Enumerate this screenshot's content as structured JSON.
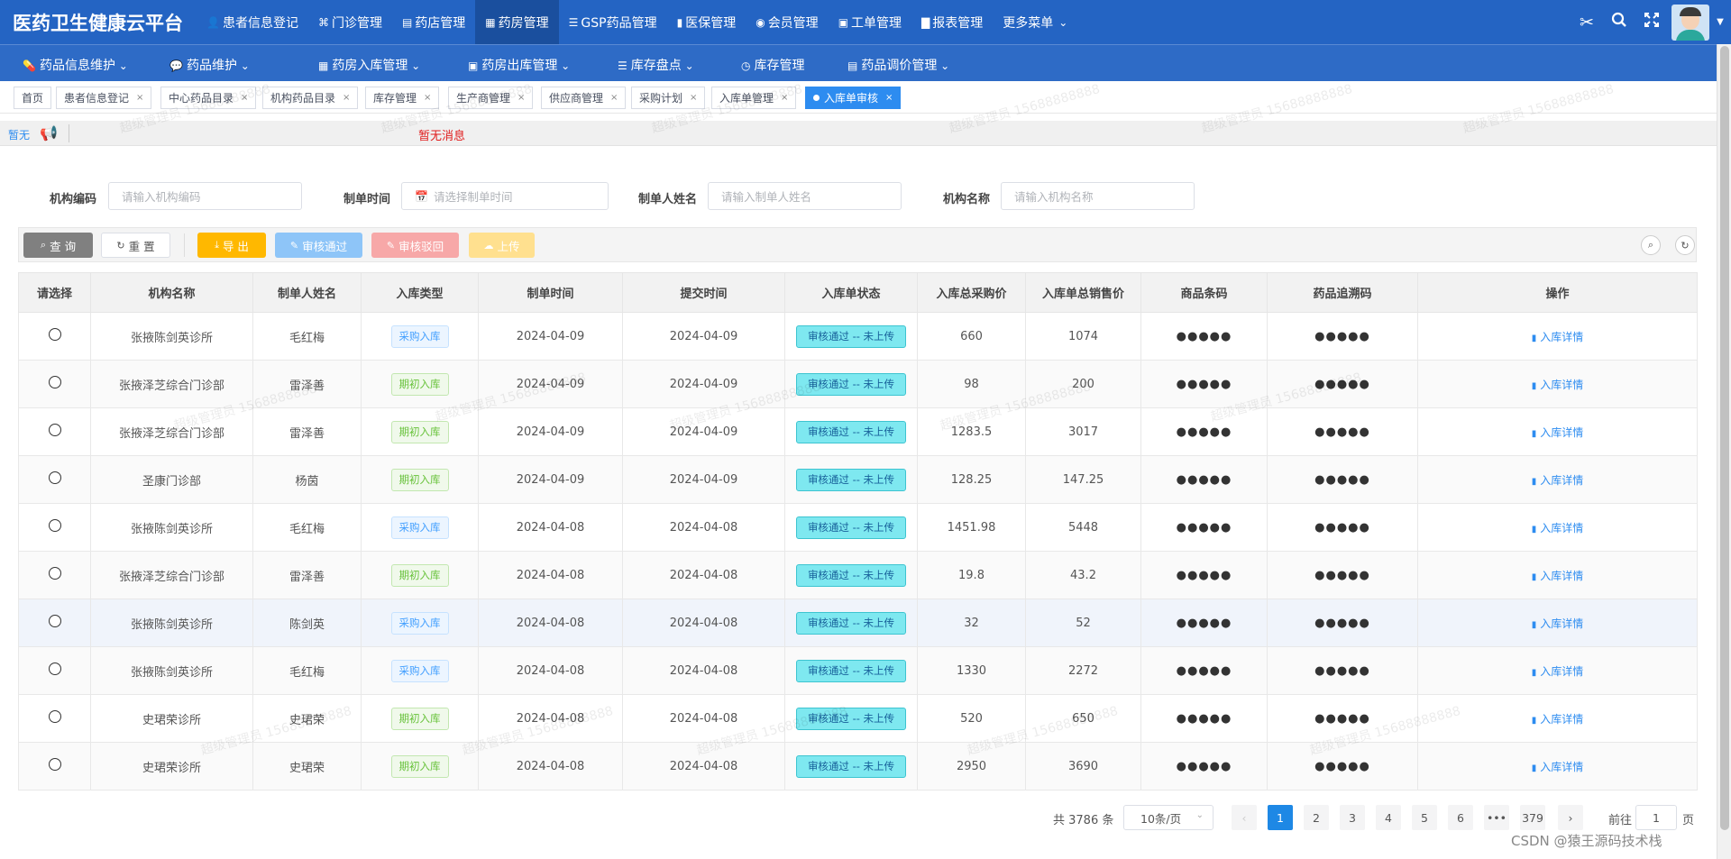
{
  "app": {
    "title": "医药卫生健康云平台"
  },
  "top_menu": [
    {
      "label": "患者信息登记",
      "icon": "user-icon"
    },
    {
      "label": "门诊管理",
      "icon": "puzzle-icon"
    },
    {
      "label": "药店管理",
      "icon": "store-icon"
    },
    {
      "label": "药房管理",
      "icon": "pharmacy-icon",
      "active": true
    },
    {
      "label": "GSP药品管理",
      "icon": "list-icon"
    },
    {
      "label": "医保管理",
      "icon": "card-icon"
    },
    {
      "label": "会员管理",
      "icon": "github-icon"
    },
    {
      "label": "工单管理",
      "icon": "ticket-icon"
    },
    {
      "label": "报表管理",
      "icon": "chart-icon"
    },
    {
      "label": "更多菜单",
      "icon": "chevron-down-icon"
    }
  ],
  "sub_menu": [
    {
      "label": "药品信息维护",
      "icon": "pill-icon"
    },
    {
      "label": "药品维护",
      "icon": "chat-icon"
    },
    {
      "label": "药房入库管理",
      "icon": "grid-icon"
    },
    {
      "label": "药房出库管理",
      "icon": "box-icon"
    },
    {
      "label": "库存盘点",
      "icon": "list-icon"
    },
    {
      "label": "库存管理",
      "icon": "clock-icon"
    },
    {
      "label": "药品调价管理",
      "icon": "doc-icon"
    }
  ],
  "tags": [
    {
      "label": "首页"
    },
    {
      "label": "患者信息登记"
    },
    {
      "label": "中心药品目录"
    },
    {
      "label": "机构药品目录"
    },
    {
      "label": "库存管理"
    },
    {
      "label": "生产商管理"
    },
    {
      "label": "供应商管理"
    },
    {
      "label": "采购计划"
    },
    {
      "label": "入库单管理"
    },
    {
      "label": "入库单审核",
      "active": true
    }
  ],
  "message": {
    "left": "暂无",
    "text": "暂无消息"
  },
  "filters": [
    {
      "label": "机构编码",
      "placeholder": "请输入机构编码"
    },
    {
      "label": "制单时间",
      "placeholder": "请选择制单时间"
    },
    {
      "label": "制单人姓名",
      "placeholder": "请输入制单人姓名"
    },
    {
      "label": "机构名称",
      "placeholder": "请输入机构名称"
    }
  ],
  "toolbar": {
    "search": "查 询",
    "reset": "重 置",
    "export": "导 出",
    "approve": "审核通过",
    "reject": "审核驳回",
    "upload": "上传"
  },
  "colors": {
    "primary": "#2464c3",
    "search_btn": "#808080",
    "export_btn": "#ffb800",
    "approve_btn": "#8ec5f8",
    "reject_btn": "#f7a8a8",
    "upload_btn": "#ffe08f"
  },
  "table": {
    "columns": [
      "请选择",
      "机构名称",
      "制单人姓名",
      "入库类型",
      "制单时间",
      "提交时间",
      "入库单状态",
      "入库总采购价",
      "入库单总销售价",
      "商品条码",
      "药品追溯码",
      "操作"
    ],
    "rows": [
      {
        "org": "张掖陈剑英诊所",
        "maker": "毛红梅",
        "type": "采购入库",
        "type_kind": "cg",
        "created": "2024-04-09",
        "submitted": "2024-04-09",
        "status": "审核通过 -- 未上传",
        "buy": "660",
        "sell": "1074",
        "barcode": "●●●●●",
        "trace": "●●●●●",
        "op": "入库详情"
      },
      {
        "org": "张掖泽芝综合门诊部",
        "maker": "雷泽善",
        "type": "期初入库",
        "type_kind": "qc",
        "created": "2024-04-09",
        "submitted": "2024-04-09",
        "status": "审核通过 -- 未上传",
        "buy": "98",
        "sell": "200",
        "barcode": "●●●●●",
        "trace": "●●●●●",
        "op": "入库详情"
      },
      {
        "org": "张掖泽芝综合门诊部",
        "maker": "雷泽善",
        "type": "期初入库",
        "type_kind": "qc",
        "created": "2024-04-09",
        "submitted": "2024-04-09",
        "status": "审核通过 -- 未上传",
        "buy": "1283.5",
        "sell": "3017",
        "barcode": "●●●●●",
        "trace": "●●●●●",
        "op": "入库详情"
      },
      {
        "org": "圣康门诊部",
        "maker": "杨茵",
        "type": "期初入库",
        "type_kind": "qc",
        "created": "2024-04-09",
        "submitted": "2024-04-09",
        "status": "审核通过 -- 未上传",
        "buy": "128.25",
        "sell": "147.25",
        "barcode": "●●●●●",
        "trace": "●●●●●",
        "op": "入库详情"
      },
      {
        "org": "张掖陈剑英诊所",
        "maker": "毛红梅",
        "type": "采购入库",
        "type_kind": "cg",
        "created": "2024-04-08",
        "submitted": "2024-04-08",
        "status": "审核通过 -- 未上传",
        "buy": "1451.98",
        "sell": "5448",
        "barcode": "●●●●●",
        "trace": "●●●●●",
        "op": "入库详情"
      },
      {
        "org": "张掖泽芝综合门诊部",
        "maker": "雷泽善",
        "type": "期初入库",
        "type_kind": "qc",
        "created": "2024-04-08",
        "submitted": "2024-04-08",
        "status": "审核通过 -- 未上传",
        "buy": "19.8",
        "sell": "43.2",
        "barcode": "●●●●●",
        "trace": "●●●●●",
        "op": "入库详情"
      },
      {
        "org": "张掖陈剑英诊所",
        "maker": "陈剑英",
        "type": "采购入库",
        "type_kind": "cg",
        "created": "2024-04-08",
        "submitted": "2024-04-08",
        "status": "审核通过 -- 未上传",
        "buy": "32",
        "sell": "52",
        "barcode": "●●●●●",
        "trace": "●●●●●",
        "op": "入库详情"
      },
      {
        "org": "张掖陈剑英诊所",
        "maker": "毛红梅",
        "type": "采购入库",
        "type_kind": "cg",
        "created": "2024-04-08",
        "submitted": "2024-04-08",
        "status": "审核通过 -- 未上传",
        "buy": "1330",
        "sell": "2272",
        "barcode": "●●●●●",
        "trace": "●●●●●",
        "op": "入库详情"
      },
      {
        "org": "史珺荣诊所",
        "maker": "史珺荣",
        "type": "期初入库",
        "type_kind": "qc",
        "created": "2024-04-08",
        "submitted": "2024-04-08",
        "status": "审核通过 -- 未上传",
        "buy": "520",
        "sell": "650",
        "barcode": "●●●●●",
        "trace": "●●●●●",
        "op": "入库详情"
      },
      {
        "org": "史珺荣诊所",
        "maker": "史珺荣",
        "type": "期初入库",
        "type_kind": "qc",
        "created": "2024-04-08",
        "submitted": "2024-04-08",
        "status": "审核通过 -- 未上传",
        "buy": "2950",
        "sell": "3690",
        "barcode": "●●●●●",
        "trace": "●●●●●",
        "op": "入库详情"
      }
    ]
  },
  "pagination": {
    "total": "共 3786 条",
    "page_size": "10条/页",
    "pages": [
      "1",
      "2",
      "3",
      "4",
      "5",
      "6",
      "•••",
      "379"
    ],
    "current": "1",
    "goto_label": "前往",
    "goto_value": "1",
    "page_suffix": "页"
  },
  "watermark": "超级管理员 15688888888",
  "footer": {
    "csdn": "CSDN @猿王源码技术栈"
  }
}
